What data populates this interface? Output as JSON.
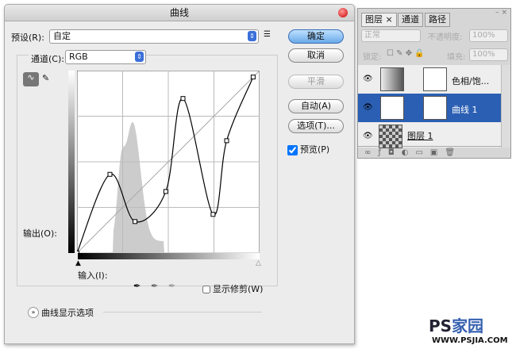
{
  "dialog": {
    "title": "曲线",
    "preset_label": "预设(R):",
    "preset_value": "自定",
    "channel_label": "通道(C):",
    "channel_value": "RGB",
    "output_label": "输出(O):",
    "input_label": "输入(I):",
    "show_clipping": "显示修剪(W)",
    "show_clipping_checked": false,
    "display_options": "曲线显示选项"
  },
  "buttons": {
    "ok": "确定",
    "cancel": "取消",
    "smooth": "平滑",
    "auto": "自动(A)",
    "options": "选项(T)...",
    "preview": "预览(P)",
    "preview_checked": true
  },
  "chart_data": {
    "type": "line",
    "x": [
      0,
      46,
      81,
      124,
      148,
      190,
      209,
      246
    ],
    "y": [
      0,
      110,
      44,
      86,
      216,
      54,
      157,
      246
    ],
    "xlim": [
      0,
      255
    ],
    "ylim": [
      0,
      255
    ],
    "grid": "4x4"
  },
  "layers_panel": {
    "tabs": [
      "图层 ×",
      "通道",
      "路径"
    ],
    "blend_mode": "正常",
    "opacity_label": "不透明度:",
    "opacity": "100%",
    "lock_label": "锁定:",
    "fill_label": "填充:",
    "fill": "100%",
    "layers": [
      {
        "name": "色相/饱...",
        "selected": false
      },
      {
        "name": "曲线 1",
        "selected": true
      },
      {
        "name": "图层 1",
        "selected": false
      }
    ]
  },
  "watermark": {
    "logo": "PS家园",
    "url": "WWW.PSJIA.COM"
  }
}
